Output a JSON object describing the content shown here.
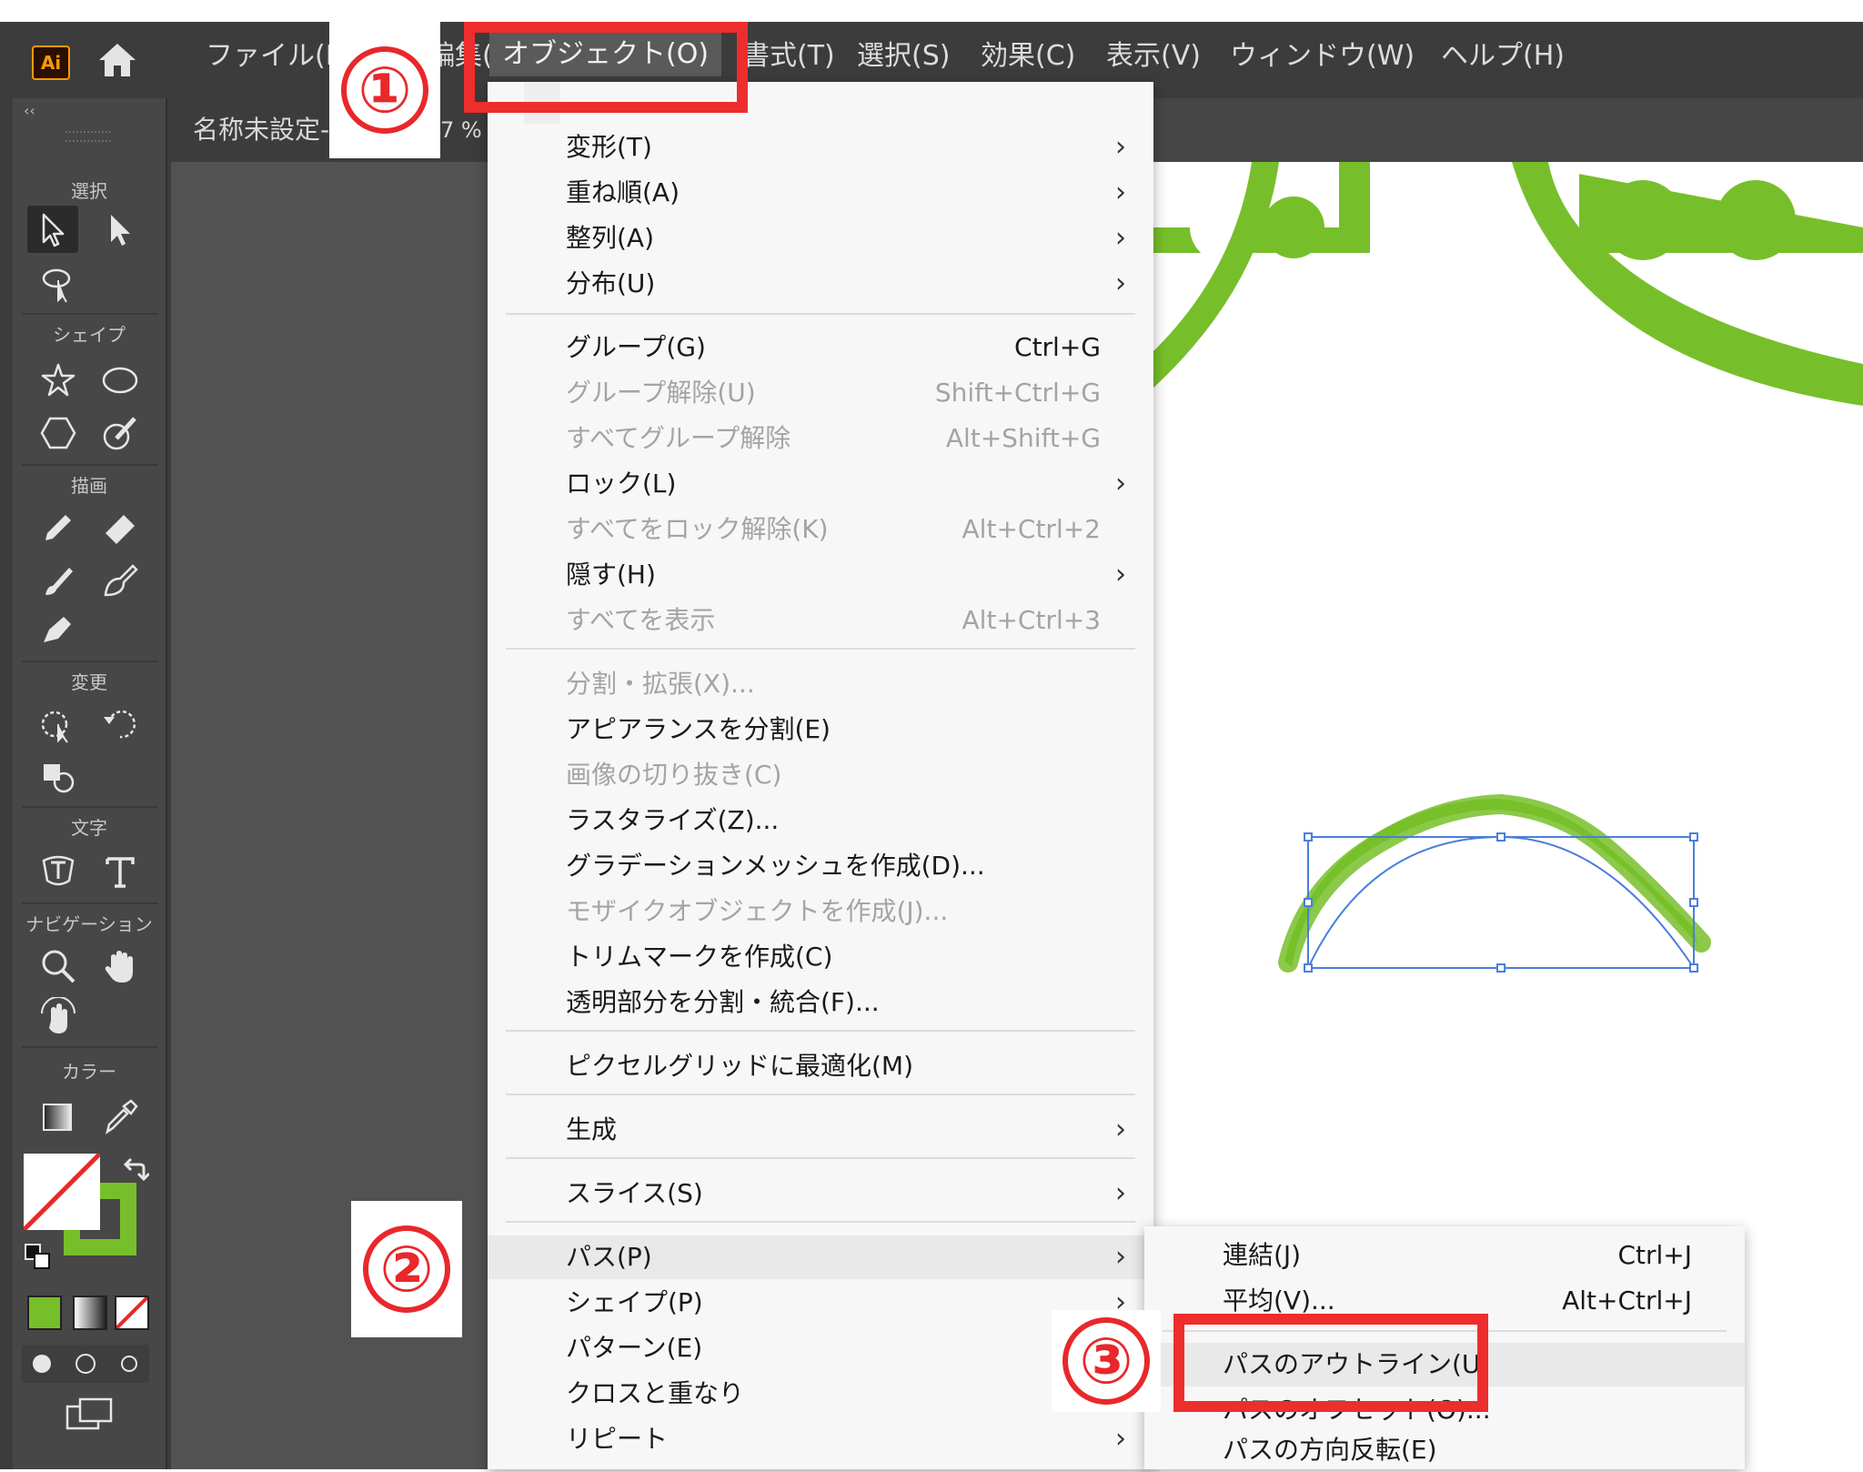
{
  "app": {
    "logo_text": "Ai",
    "menus": [
      "ファイル(F)",
      "編集(E)",
      "オブジェクト(O)",
      "書式(T)",
      "選択(S)",
      "効果(C)",
      "表示(V)",
      "ウィンドウ(W)",
      "ヘルプ(H)"
    ]
  },
  "document": {
    "tab_title": "名称未設定-1 @ 67 %",
    "tab_visible": "名称未設定-",
    "zoom_fragment": "7 %"
  },
  "toolbar": {
    "collapse_glyph": "‹‹",
    "groups": {
      "select": "選択",
      "shape": "シェイプ",
      "draw": "描画",
      "modify": "変更",
      "type": "文字",
      "navigate": "ナビゲーション",
      "color": "カラー"
    }
  },
  "object_menu": {
    "items": [
      {
        "label": "変形(T)",
        "shortcut": "",
        "submenu": true,
        "enabled": true
      },
      {
        "label": "重ね順(A)",
        "shortcut": "",
        "submenu": true,
        "enabled": true
      },
      {
        "label": "整列(A)",
        "shortcut": "",
        "submenu": true,
        "enabled": true
      },
      {
        "label": "分布(U)",
        "shortcut": "",
        "submenu": true,
        "enabled": true
      },
      {
        "label": "グループ(G)",
        "shortcut": "Ctrl+G",
        "submenu": false,
        "enabled": true
      },
      {
        "label": "グループ解除(U)",
        "shortcut": "Shift+Ctrl+G",
        "submenu": false,
        "enabled": false
      },
      {
        "label": "すべてグループ解除",
        "shortcut": "Alt+Shift+G",
        "submenu": false,
        "enabled": false
      },
      {
        "label": "ロック(L)",
        "shortcut": "",
        "submenu": true,
        "enabled": true
      },
      {
        "label": "すべてをロック解除(K)",
        "shortcut": "Alt+Ctrl+2",
        "submenu": false,
        "enabled": false
      },
      {
        "label": "隠す(H)",
        "shortcut": "",
        "submenu": true,
        "enabled": true
      },
      {
        "label": "すべてを表示",
        "shortcut": "Alt+Ctrl+3",
        "submenu": false,
        "enabled": false
      },
      {
        "label": "分割・拡張(X)...",
        "shortcut": "",
        "submenu": false,
        "enabled": false
      },
      {
        "label": "アピアランスを分割(E)",
        "shortcut": "",
        "submenu": false,
        "enabled": true
      },
      {
        "label": "画像の切り抜き(C)",
        "shortcut": "",
        "submenu": false,
        "enabled": false
      },
      {
        "label": "ラスタライズ(Z)...",
        "shortcut": "",
        "submenu": false,
        "enabled": true
      },
      {
        "label": "グラデーションメッシュを作成(D)...",
        "shortcut": "",
        "submenu": false,
        "enabled": true
      },
      {
        "label": "モザイクオブジェクトを作成(J)...",
        "shortcut": "",
        "submenu": false,
        "enabled": false
      },
      {
        "label": "トリムマークを作成(C)",
        "shortcut": "",
        "submenu": false,
        "enabled": true
      },
      {
        "label": "透明部分を分割・統合(F)...",
        "shortcut": "",
        "submenu": false,
        "enabled": true
      },
      {
        "label": "ピクセルグリッドに最適化(M)",
        "shortcut": "",
        "submenu": false,
        "enabled": true
      },
      {
        "label": "生成",
        "shortcut": "",
        "submenu": true,
        "enabled": true
      },
      {
        "label": "スライス(S)",
        "shortcut": "",
        "submenu": true,
        "enabled": true
      },
      {
        "label": "パス(P)",
        "shortcut": "",
        "submenu": true,
        "enabled": true,
        "highlighted": true
      },
      {
        "label": "シェイプ(P)",
        "shortcut": "",
        "submenu": true,
        "enabled": true
      },
      {
        "label": "パターン(E)",
        "shortcut": "",
        "submenu": true,
        "enabled": true
      },
      {
        "label": "クロスと重なり",
        "shortcut": "",
        "submenu": true,
        "enabled": true
      },
      {
        "label": "リピート",
        "shortcut": "",
        "submenu": true,
        "enabled": true
      }
    ]
  },
  "path_submenu": {
    "items": [
      {
        "label": "連結(J)",
        "shortcut": "Ctrl+J"
      },
      {
        "label": "平均(V)...",
        "shortcut": "Alt+Ctrl+J"
      },
      {
        "label": "パスのアウトライン(U)",
        "shortcut": "",
        "highlighted": true
      },
      {
        "label": "パスのオフセット(O)...",
        "shortcut": ""
      },
      {
        "label": "パスの方向反転(E)",
        "shortcut": ""
      }
    ]
  },
  "callouts": {
    "step1": "①",
    "step2": "②",
    "step3": "③"
  },
  "colors": {
    "accent_red": "#ee2d2d",
    "artwork_green": "#77bf2a",
    "selection_blue": "#4a7fd8",
    "ui_dark": "#3c3c3c",
    "menu_bg": "#f7f7f7"
  },
  "icons": [
    "home-icon",
    "selection-tool-icon",
    "direct-selection-tool-icon",
    "lasso-tool-icon",
    "star-tool-icon",
    "ellipse-tool-icon",
    "polygon-tool-icon",
    "shaper-tool-icon",
    "pencil-tool-icon",
    "eraser-tool-icon",
    "paintbrush-tool-icon",
    "blob-brush-tool-icon",
    "pen-tool-icon",
    "free-transform-tool-icon",
    "rotate-tool-icon",
    "shape-builder-tool-icon",
    "type-on-path-tool-icon",
    "type-tool-icon",
    "zoom-tool-icon",
    "hand-tool-icon",
    "rotate-view-tool-icon",
    "gradient-tool-icon",
    "eyedropper-tool-icon",
    "swap-colors-icon",
    "default-colors-icon",
    "fill-swatch-icon",
    "stroke-swatch-icon",
    "draw-mode-icon",
    "screen-mode-icon"
  ]
}
